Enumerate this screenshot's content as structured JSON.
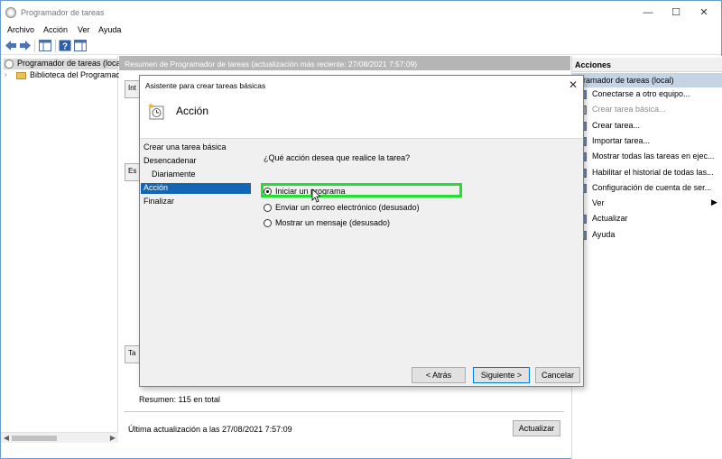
{
  "window": {
    "title": "Programador de tareas",
    "controls": {
      "minimize": "—",
      "maximize": "☐",
      "close": "✕"
    }
  },
  "menu": [
    "Archivo",
    "Acción",
    "Ver",
    "Ayuda"
  ],
  "toolbar_icons": [
    "back-arrow-icon",
    "forward-arrow-icon",
    "console-tree-icon",
    "help-icon",
    "show-hide-pane-icon"
  ],
  "tree": {
    "root": "Programador de tareas (local",
    "child": "Biblioteca del Programad"
  },
  "center": {
    "header": "Resumen de Programador de tareas (actualización más reciente: 27/08/2021 7:57:09)",
    "stubs": [
      "Int",
      "Es",
      "Ta"
    ],
    "summary": "Resumen: 115 en total",
    "last_update": "Última actualización a las 27/08/2021 7:57:09",
    "refresh_button": "Actualizar"
  },
  "actions": {
    "header": "Acciones",
    "section": "Programador de tareas (local)",
    "items": [
      {
        "label": "Conectarse a otro equipo...",
        "enabled": true,
        "icon": "computer-icon"
      },
      {
        "label": "Crear tarea básica...",
        "enabled": false,
        "icon": "basic-task-icon"
      },
      {
        "label": "Crear tarea...",
        "enabled": true,
        "icon": "task-icon"
      },
      {
        "label": "Importar tarea...",
        "enabled": true,
        "icon": "import-icon"
      },
      {
        "label": "Mostrar todas las tareas en ejec...",
        "enabled": true,
        "icon": "running-tasks-icon"
      },
      {
        "label": "Habilitar el historial de todas las...",
        "enabled": true,
        "icon": "history-icon"
      },
      {
        "label": "Configuración de cuenta de ser...",
        "enabled": true,
        "icon": "account-icon"
      },
      {
        "label": "Ver",
        "enabled": true,
        "icon": ""
      },
      {
        "label": "Actualizar",
        "enabled": true,
        "icon": "refresh-icon"
      },
      {
        "label": "Ayuda",
        "enabled": true,
        "icon": "help-icon"
      }
    ]
  },
  "dialog": {
    "title": "Asistente para crear tareas básicas",
    "header": "Acción",
    "steps": [
      "Crear una tarea básica",
      "Desencadenar",
      "Diariamente",
      "Acción",
      "Finalizar"
    ],
    "current_step": "Acción",
    "question": "¿Qué acción desea que realice la tarea?",
    "options": [
      {
        "label": "Iniciar un programa",
        "selected": true
      },
      {
        "label": "Enviar un correo electrónico (desusado)",
        "selected": false
      },
      {
        "label": "Mostrar un mensaje (desusado)",
        "selected": false
      }
    ],
    "buttons": {
      "back": "< Atrás",
      "next": "Siguiente >",
      "cancel": "Cancelar"
    }
  },
  "colors": {
    "highlight": "#22e02e",
    "selection": "#1366b6",
    "actions_section": "#c5d4e4"
  }
}
